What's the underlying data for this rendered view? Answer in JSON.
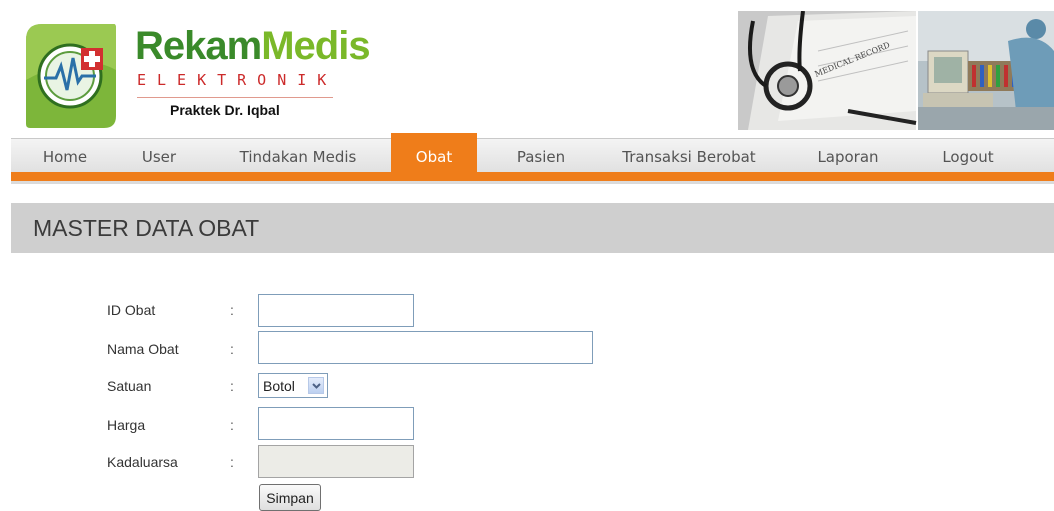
{
  "brand": {
    "name_part1": "Rekam",
    "name_part2": "Medis",
    "subtitle": "ELEKTRONIK",
    "praktek": "Praktek Dr. Iqbal",
    "photo_text": "MEDICAL RECORD"
  },
  "nav": {
    "items": [
      {
        "label": "Home"
      },
      {
        "label": "User"
      },
      {
        "label": "Tindakan Medis"
      },
      {
        "label": "Obat",
        "active": true
      },
      {
        "label": "Pasien"
      },
      {
        "label": "Transaksi Berobat"
      },
      {
        "label": "Laporan"
      },
      {
        "label": "Logout"
      }
    ]
  },
  "page": {
    "title": "MASTER DATA OBAT"
  },
  "form": {
    "separator": ":",
    "id_obat": {
      "label": "ID Obat",
      "value": ""
    },
    "nama_obat": {
      "label": "Nama Obat",
      "value": ""
    },
    "satuan": {
      "label": "Satuan",
      "value": "Botol"
    },
    "harga": {
      "label": "Harga",
      "value": ""
    },
    "kadaluarsa": {
      "label": "Kadaluarsa",
      "value": ""
    },
    "submit_label": "Simpan"
  },
  "colors": {
    "accent_orange": "#ef7d1a",
    "brand_green": "#3a8a2a",
    "brand_red": "#cc2a2a"
  }
}
